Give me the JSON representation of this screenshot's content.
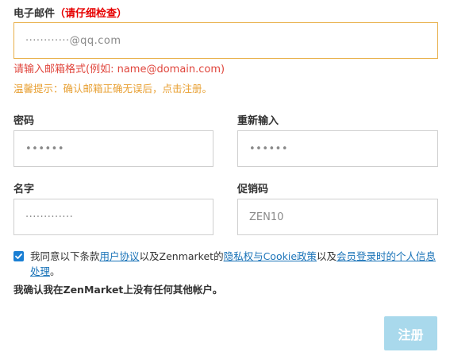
{
  "email": {
    "label": "电子邮件",
    "required_note": "（请仔细检查）",
    "value": "············@qq.com",
    "error": "请输入邮箱格式(例如: name@domain.com)",
    "tip": "温馨提示：确认邮箱正确无误后，点击注册。"
  },
  "password": {
    "label": "密码",
    "value": "••••••"
  },
  "password_confirm": {
    "label": "重新输入",
    "value": "••••••"
  },
  "name": {
    "label": "名字",
    "value": "·············"
  },
  "promo": {
    "label": "促销码",
    "value": "ZEN10"
  },
  "agreement": {
    "checked": true,
    "text_1": "我同意以下条款",
    "link_terms": "用户协议",
    "text_2": "以及Zenmarket的",
    "link_privacy": "隐私权与Cookie政策",
    "text_3": "以及",
    "link_member": "会员登录时的个人信息处理",
    "text_4": "。"
  },
  "confirm_text": "我确认我在ZenMarket上没有任何其他帐户。",
  "submit_label": "注册",
  "colors": {
    "required": "#e60000",
    "error": "#e0463d",
    "tip": "#e8a033",
    "focus_border": "#e8b04a",
    "link": "#1a73b8",
    "checkbox": "#1a7fd4",
    "submit_bg": "#a9d9ec"
  }
}
